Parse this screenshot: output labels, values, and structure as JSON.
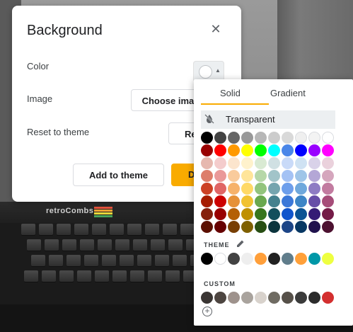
{
  "dialog": {
    "title": "Background",
    "labels": {
      "color": "Color",
      "image": "Image",
      "reset": "Reset to theme"
    },
    "buttons": {
      "choose_image": "Choose image",
      "reset": "Reset",
      "add_to_theme": "Add to theme",
      "done": "Done"
    }
  },
  "background_logo": "retroCombs",
  "popup": {
    "tabs": [
      "Solid",
      "Gradient"
    ],
    "active_tab": "Solid",
    "transparent_label": "Transparent",
    "theme_label": "THEME",
    "custom_label": "CUSTOM",
    "palette": [
      [
        "#000000",
        "#434343",
        "#666666",
        "#999999",
        "#b7b7b7",
        "#cccccc",
        "#d9d9d9",
        "#efefef",
        "#f3f3f3",
        "#ffffff"
      ],
      [
        "#980000",
        "#ff0000",
        "#ff9900",
        "#ffff00",
        "#00ff00",
        "#00ffff",
        "#4a86e8",
        "#0000ff",
        "#9900ff",
        "#ff00ff"
      ],
      [
        "#e6b8af",
        "#f4cccc",
        "#fce5cd",
        "#fff2cc",
        "#d9ead3",
        "#d0e0e3",
        "#c9daf8",
        "#cfe2f3",
        "#d9d2e9",
        "#ead1dc"
      ],
      [
        "#dd7e6b",
        "#ea9999",
        "#f9cb9c",
        "#ffe599",
        "#b6d7a8",
        "#a2c4c9",
        "#a4c2f4",
        "#9fc5e8",
        "#b4a7d6",
        "#d5a6bd"
      ],
      [
        "#cc4125",
        "#e06666",
        "#f6b26b",
        "#ffd966",
        "#93c47d",
        "#76a5af",
        "#6d9eeb",
        "#6fa8dc",
        "#8e7cc3",
        "#c27ba0"
      ],
      [
        "#a61c00",
        "#cc0000",
        "#e69138",
        "#f1c232",
        "#6aa84f",
        "#45818e",
        "#3c78d8",
        "#3d85c6",
        "#674ea7",
        "#a64d79"
      ],
      [
        "#85200c",
        "#990000",
        "#b45f06",
        "#bf9000",
        "#38761d",
        "#134f5c",
        "#1155cc",
        "#0b5394",
        "#351c75",
        "#741b47"
      ],
      [
        "#5b0f00",
        "#660000",
        "#783f04",
        "#7f6000",
        "#274e13",
        "#0c343d",
        "#1c4587",
        "#073763",
        "#20124d",
        "#4c1130"
      ]
    ],
    "theme_colors": [
      "#000000",
      "#ffffff",
      "#424242",
      "#eeeeee",
      "#ff9f3a",
      "#212121",
      "#607d8b",
      "#ffa039",
      "#0097a7",
      "#eeff41"
    ],
    "custom_colors": [
      "#3a3533",
      "#4d4541",
      "#9e928c",
      "#a9a39d",
      "#d8d2cc",
      "#6f6b62",
      "#565049",
      "#3b3b3b",
      "#2b2b2b",
      "#d32f2f"
    ]
  }
}
